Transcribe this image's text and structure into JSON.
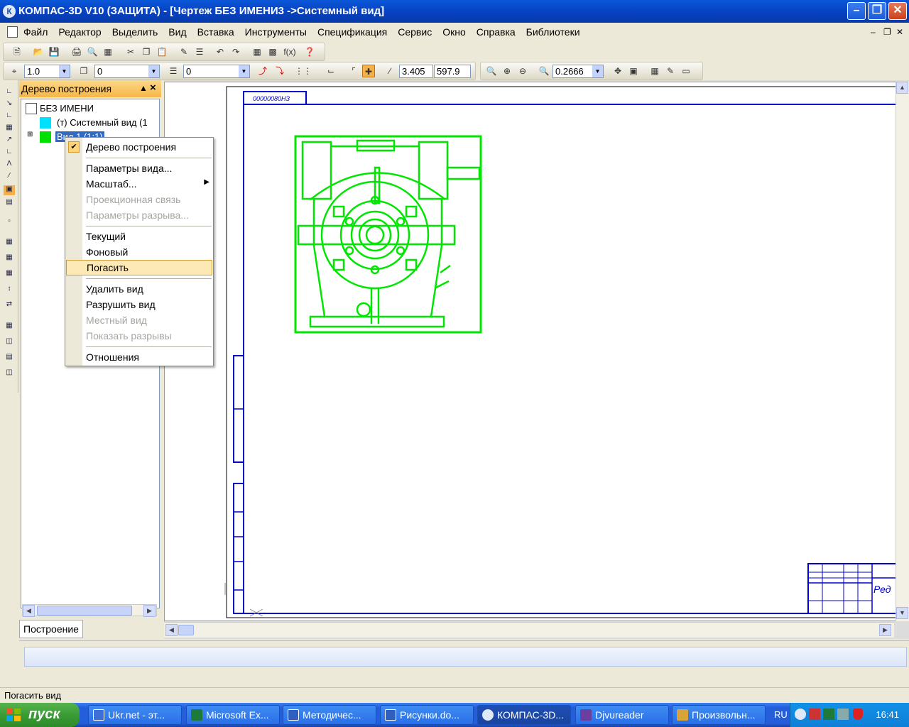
{
  "window": {
    "title": "КОМПАС-3D V10 (ЗАЩИТА) - [Чертеж БЕЗ ИМЕНИ3 ->Системный вид]",
    "app_icon": "К"
  },
  "menu": {
    "items": [
      "Файл",
      "Редактор",
      "Выделить",
      "Вид",
      "Вставка",
      "Инструменты",
      "Спецификация",
      "Сервис",
      "Окно",
      "Справка",
      "Библиотеки"
    ]
  },
  "toolbar": {
    "scale_value": "1.0",
    "layer_value": "0",
    "style_value": "0",
    "coord_x": "3.405",
    "coord_y": "597.9",
    "zoom_value": "0.2666"
  },
  "tree": {
    "title": "Дерево построения",
    "root": "БЕЗ ИМЕНИ",
    "node1": "(т) Системный вид (1",
    "node2": "Вид 1 (1:1)",
    "tab": "Построение"
  },
  "context_menu": {
    "items": [
      {
        "label": "Дерево построения",
        "checked": true
      },
      {
        "label": "Параметры вида..."
      },
      {
        "label": "Масштаб...",
        "submenu": true
      },
      {
        "label": "Проекционная связь",
        "disabled": true
      },
      {
        "label": "Параметры разрыва...",
        "disabled": true
      },
      {
        "label": "Текущий"
      },
      {
        "label": "Фоновый"
      },
      {
        "label": "Погасить",
        "highlighted": true
      },
      {
        "label": "Удалить вид"
      },
      {
        "label": "Разрушить вид"
      },
      {
        "label": "Местный вид",
        "disabled": true
      },
      {
        "label": "Показать разрывы",
        "disabled": true
      },
      {
        "label": "Отношения"
      }
    ]
  },
  "drawing": {
    "stamp_text": "00000080НЗ",
    "titleblock_text": "Ред"
  },
  "status": {
    "text": "Погасить вид"
  },
  "taskbar": {
    "start": "пуск",
    "tasks": [
      "Ukr.net - эт...",
      "Microsoft Ex...",
      "Методичес...",
      "Рисунки.do...",
      "КОМПАС-3D...",
      "Djvureader",
      "Произвольн..."
    ],
    "lang": "RU",
    "clock": "16:41"
  },
  "colors": {
    "titlebar": "#0842c4",
    "drawing_green": "#00e600",
    "frame_blue": "#0000cc",
    "menu_highlight": "#fde9b5"
  }
}
